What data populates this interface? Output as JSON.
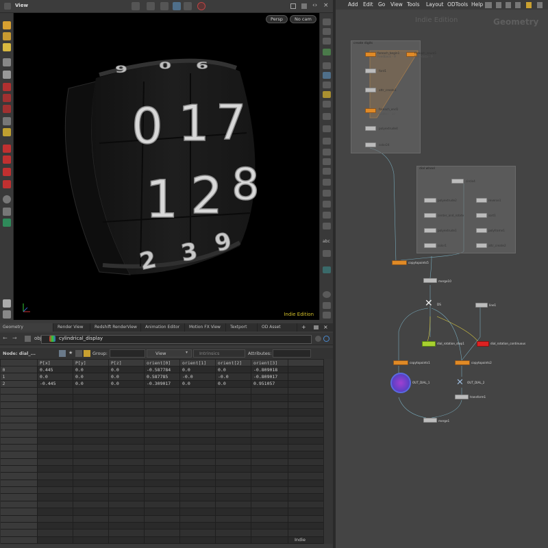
{
  "viewer": {
    "title": "View",
    "persp_label": "Persp",
    "cam_label": "No cam",
    "indie_label": "Indie Edition",
    "dial_top_digits": [
      "0",
      "1",
      "7"
    ],
    "dial_mid_digits": [
      "1",
      "2",
      "8"
    ],
    "dial_bottom_digits": [
      "2",
      "3",
      "9"
    ],
    "dial_peek_digits": [
      "9",
      "0",
      "6"
    ]
  },
  "bottom_tabs": [
    "Geometry Spreadsheet",
    "Render View",
    "Redshift RenderView",
    "Animation Editor",
    "Motion FX View",
    "Textport",
    "OD Asset Library"
  ],
  "path": {
    "root": "obj",
    "node": "cylindrical_display"
  },
  "spreadsheet": {
    "node_label": "Node: dial_...",
    "group_label": "Group:",
    "view_label": "View",
    "intrinsics_label": "Intrinsics",
    "attributes_label": "Attributes:",
    "columns": [
      "",
      "P[x]",
      "P[y]",
      "P[z]",
      "orient[0]",
      "orient[1]",
      "orient[2]",
      "orient[3]"
    ],
    "rows": [
      [
        "0",
        "0.445",
        "0.0",
        "0.0",
        "-0.587784",
        "0.0",
        "0.0",
        "-0.809018"
      ],
      [
        "1",
        "0.0",
        "0.0",
        "0.0",
        "0.587785",
        "-0.0",
        "-0.0",
        "-0.809017"
      ],
      [
        "2",
        "-0.445",
        "0.0",
        "0.0",
        "-0.309017",
        "0.0",
        "0.0",
        "0.951057"
      ]
    ],
    "status": "Indie"
  },
  "network": {
    "menu": [
      "Add",
      "Edit",
      "Go",
      "View",
      "Tools",
      "Layout",
      "ODTools",
      "Help"
    ],
    "indie_label": "Indie Edition",
    "context_label": "Geometry",
    "box1_title": "create digits",
    "box2_title": "dial wheel",
    "nodes": {
      "foreach_begin1": "foreach_begin1",
      "foreach_begin1_sub": "Feedback - 9",
      "foreach_count1": "foreach_count1",
      "foreach_count1_sub": "Metadata - 9",
      "font1": "font1",
      "attr_create1": "attr_create1",
      "foreach_end1": "foreach_end1",
      "foreach_end1_sub": "Gather - 10",
      "polyextrude4": "polyextrude4",
      "color24": "color24",
      "circle4": "circle4",
      "polyextrude2": "polyextrude2",
      "reverse1": "reverse1",
      "center_and_rotate": "center_and_rotate",
      "sort1": "sort1",
      "polyextrude1": "polyextrude1",
      "polyframe1": "polyframe1",
      "attr_create2": "attr_create2",
      "color1": "color1",
      "copytopoints1": "copytopoints5",
      "merge10": "merge10",
      "ds1": "DS",
      "line1": "line1",
      "dial_rotation_step1": "dial_rotation_step1",
      "dial_rotation_continuous": "dial_rotation_continuous",
      "copytopoints2": "copytopoints1",
      "copytopoints3": "copytopoints2",
      "out_dial1": "OUT_DIAL_1",
      "out_dial2": "OUT_DIAL_2",
      "transform1": "transform1",
      "merge1": "merge1"
    }
  },
  "colors": {
    "accent_orange": "#e08a26",
    "node_green": "#a8d030",
    "node_red": "#d22222",
    "viewport_bg": "#000000"
  }
}
